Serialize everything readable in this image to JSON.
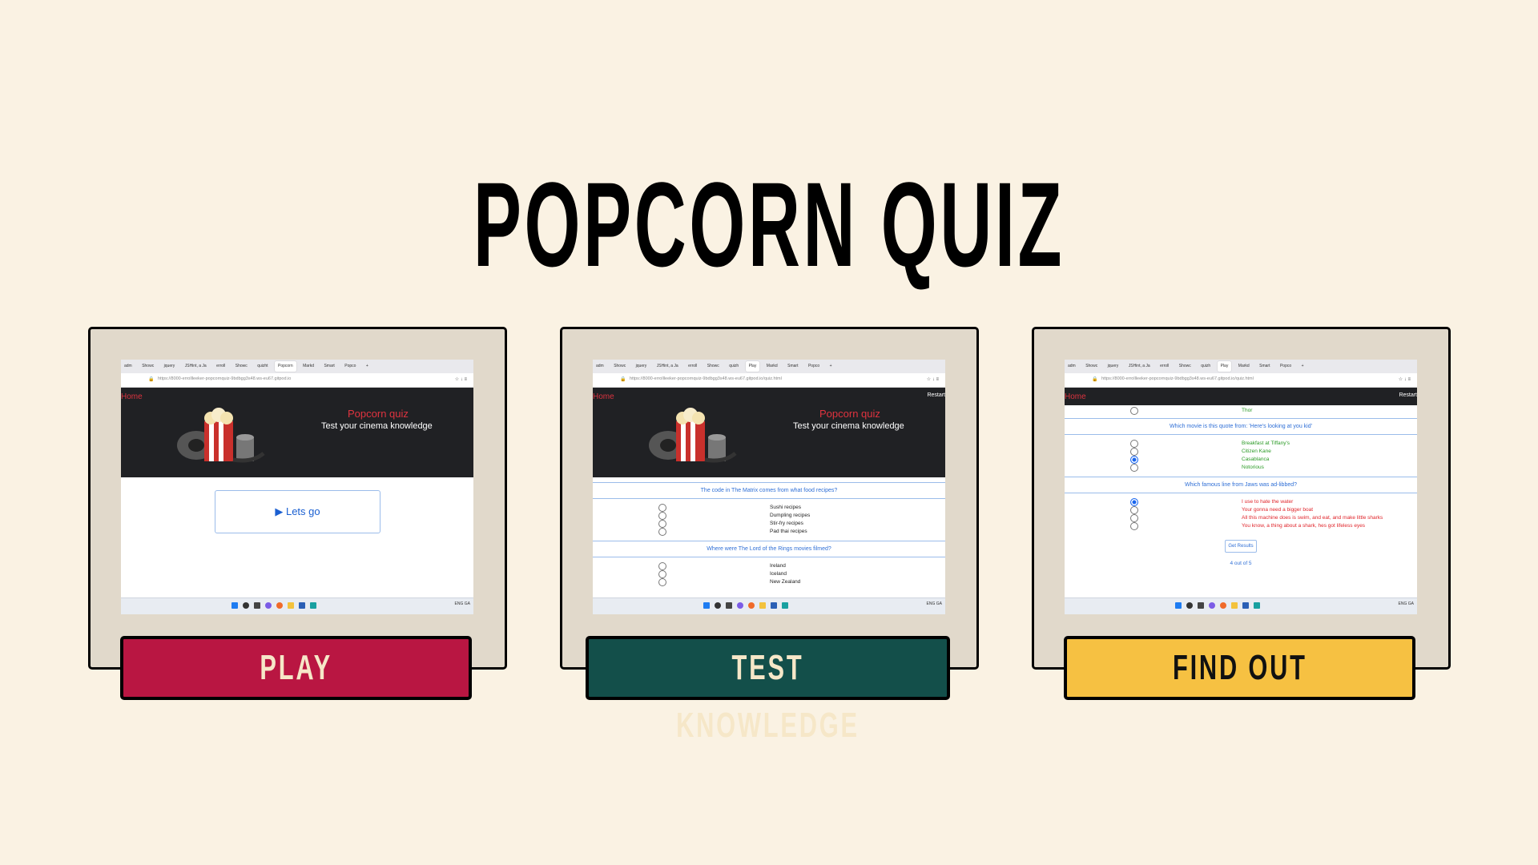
{
  "title": "POPCORN QUIZ",
  "colors": {
    "play": "#b91642",
    "test": "#134f4a",
    "find": "#f6c142",
    "background": "#faf2e3",
    "frame": "#e1d9cb"
  },
  "browser": {
    "tabs": [
      "adm",
      "Showc",
      "jquery",
      "JSHint, a Ja",
      "erroll",
      "Showc",
      "quizh",
      "Play",
      "Markd",
      "Smart",
      "Popco",
      "+"
    ],
    "tabs_play": [
      "adm",
      "Showc",
      "jquery",
      "JSHint, a Ja",
      "erroll",
      "Showc",
      "quizht",
      "Popcorn",
      "Markd",
      "Smart",
      "Popco",
      "+"
    ],
    "url_home": "https://8000-errollleeker-popcornquiz-9bdbgg3s48.ws-eu67.gitpod.io",
    "url_quiz": "https://8000-errollleeker-popcornquiz-9bdbgg3s48.ws-eu67.gitpod.io/quiz.html",
    "nav_home": "Home",
    "nav_restart": "Restart",
    "hero_title": "Popcorn quiz",
    "hero_sub": "Test your cinema knowledge",
    "tray": "ENG GA"
  },
  "play": {
    "lets_go": "▶ Lets go",
    "button_label": "PLAY"
  },
  "test": {
    "q1": "The code in The Matrix comes from what food recipes?",
    "q1_answers": [
      "Sushi recipes",
      "Dumpling recipes",
      "Stir-fry recipes",
      "Pad thai recipes"
    ],
    "q2": "Where were The Lord of the Rings movies filmed?",
    "q2_answers": [
      "Ireland",
      "Iceland",
      "New Zealand"
    ],
    "button_label": "TEST KNOWLEDGE"
  },
  "find": {
    "prev_answer": "Thor",
    "q1": "Which movie is this quote from: 'Here's looking at you kid'",
    "q1_answers": [
      "Breakfast at Tiffany's",
      "Citizen Kane",
      "Casablanca",
      "Notorious"
    ],
    "q2": "Which famous line from Jaws was ad-libbed?",
    "q2_answers": [
      "I use to hate the water",
      "Your gonna need a bigger boat",
      "All this machine does is swim, and eat, and make little sharks",
      "You know, a thing about a shark, hes got lifeless eyes"
    ],
    "get_results": "Get Results",
    "score": "4 out of 5",
    "button_label": "FIND OUT"
  }
}
